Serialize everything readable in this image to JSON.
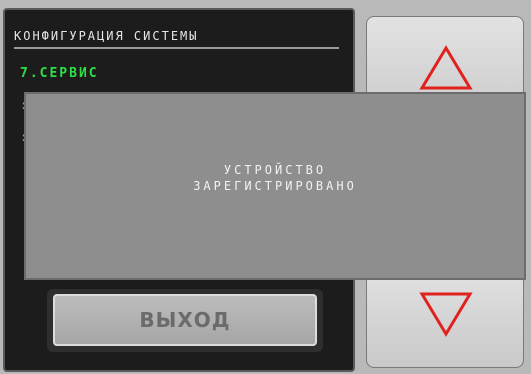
{
  "screen": {
    "title": "КОНФИГУРАЦИЯ СИСТЕМЫ",
    "menu_item": "7.СЕРВИС"
  },
  "exit_button": {
    "label": "ВЫХОД"
  },
  "dialog": {
    "line1": "УСТРОЙСТВО",
    "line2": "ЗАРЕГИСТРИРОВАНО"
  },
  "side_buttons": {
    "up_icon": "triangle-up-icon",
    "down_icon": "triangle-down-icon"
  },
  "colors": {
    "menu_green": "#2ee046",
    "arrow_red": "#e0221e"
  }
}
